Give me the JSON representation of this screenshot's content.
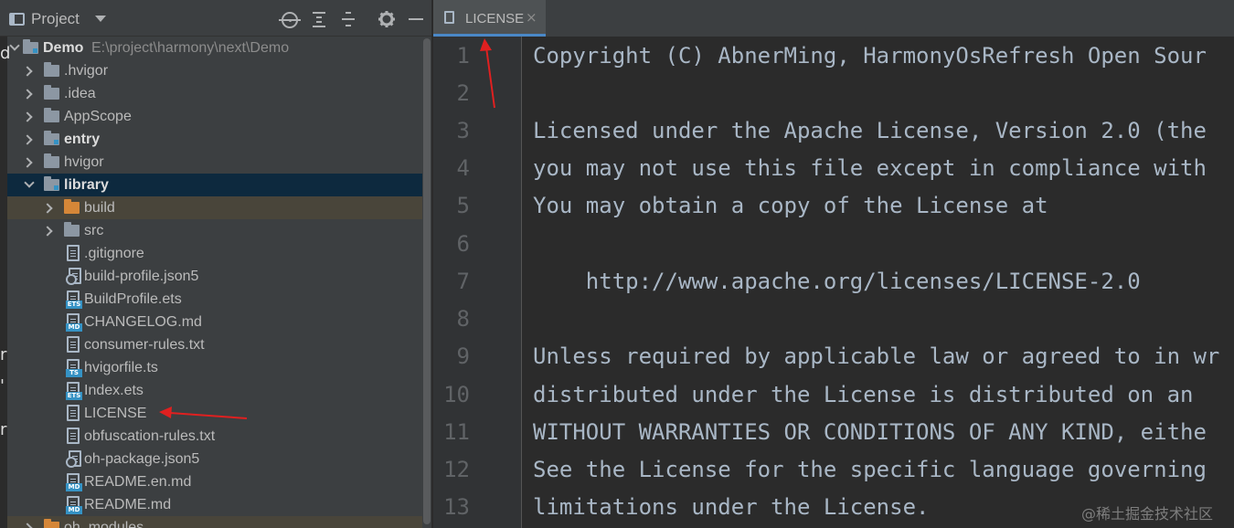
{
  "project_panel": {
    "title": "Project",
    "root": {
      "name": "Demo",
      "path": "E:\\project\\harmony\\next\\Demo"
    },
    "items": [
      {
        "label": "hvigor_dot",
        "text": ".hvigor"
      },
      {
        "text": ".idea"
      },
      {
        "text": "AppScope"
      },
      {
        "text": "entry"
      },
      {
        "text": "hvigor"
      },
      {
        "text": "library"
      },
      {
        "text": "build"
      },
      {
        "text": "src"
      },
      {
        "text": ".gitignore"
      },
      {
        "text": "build-profile.json5"
      },
      {
        "text": "BuildProfile.ets"
      },
      {
        "text": "CHANGELOG.md"
      },
      {
        "text": "consumer-rules.txt"
      },
      {
        "text": "hvigorfile.ts"
      },
      {
        "text": "Index.ets"
      },
      {
        "text": "LICENSE"
      },
      {
        "text": "obfuscation-rules.txt"
      },
      {
        "text": "oh-package.json5"
      },
      {
        "text": "README.en.md"
      },
      {
        "text": "README.md"
      },
      {
        "text": "oh_modules"
      }
    ]
  },
  "editor": {
    "tab_title": "LICENSE",
    "tab_close": "×",
    "line_numbers": [
      "1",
      "2",
      "3",
      "4",
      "5",
      "6",
      "7",
      "8",
      "9",
      "10",
      "11",
      "12",
      "13"
    ],
    "lines": [
      "Copyright (C) AbnerMing, HarmonyOsRefresh Open Sour",
      "",
      "Licensed under the Apache License, Version 2.0 (the",
      "you may not use this file except in compliance with",
      "You may obtain a copy of the License at",
      "",
      "    http://www.apache.org/licenses/LICENSE-2.0",
      "",
      "Unless required by applicable law or agreed to in wr",
      "distributed under the License is distributed on an",
      "WITHOUT WARRANTIES OR CONDITIONS OF ANY KIND, eithe",
      "See the License for the specific language governing",
      "limitations under the License."
    ]
  },
  "left_strip_glyphs": [
    "d",
    "r",
    "'",
    "r"
  ],
  "watermark": "@稀土掘金技术社区",
  "colors": {
    "selection": "#0d293e",
    "excluded_row": "#49453a",
    "tab_underline": "#4a88c7",
    "annotation_arrow": "#e02020"
  }
}
